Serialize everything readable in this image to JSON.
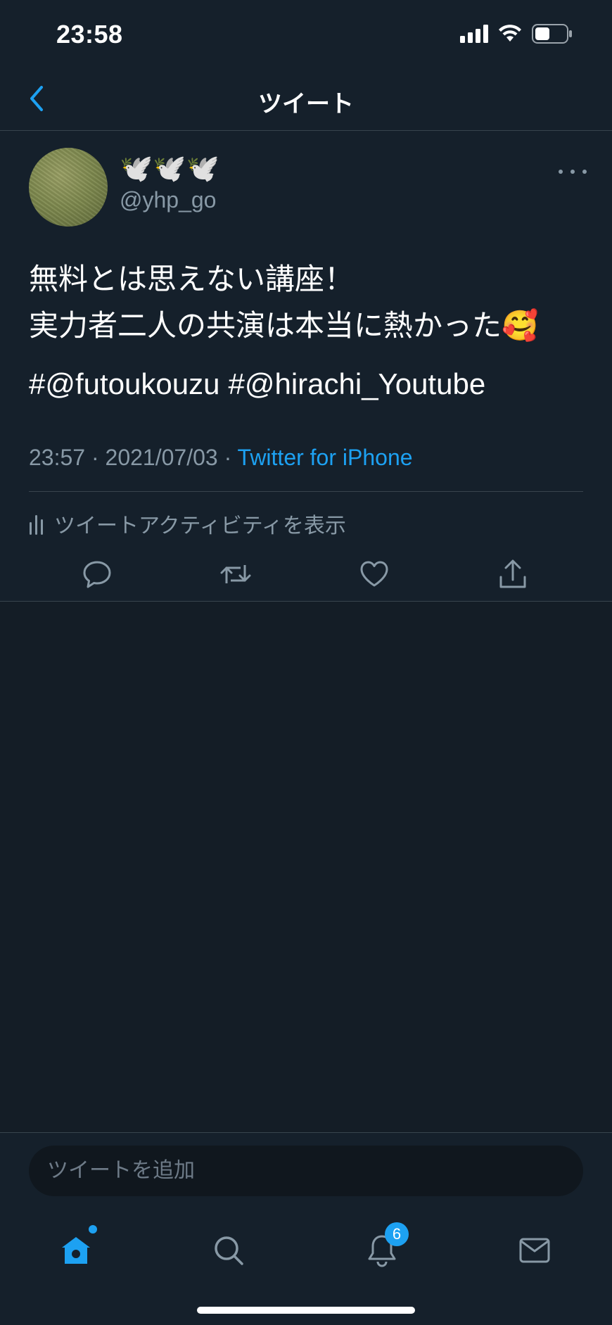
{
  "status_bar": {
    "time": "23:58"
  },
  "header": {
    "title": "ツイート"
  },
  "tweet": {
    "display_name": "🕊️🕊️🕊️",
    "handle": "@yhp_go",
    "text_lines": [
      "無料とは思えない講座！",
      "実力者二人の共演は本当に熱かった🥰"
    ],
    "hashtags": [
      "#@futoukouzu",
      "#@hirachi_Youtube"
    ],
    "time": "23:57",
    "date": "2021/07/03",
    "separator": "·",
    "source": "Twitter for iPhone",
    "activity_label": "ツイートアクティビティを表示"
  },
  "reply": {
    "placeholder": "ツイートを追加"
  },
  "tab_bar": {
    "notifications_badge": "6"
  },
  "colors": {
    "accent": "#1da1f2",
    "background": "#15202b",
    "secondary_text": "#8899a6"
  },
  "icons": {
    "back": "chevron-left-icon",
    "more": "more-horizontal-icon",
    "reply": "reply-icon",
    "retweet": "retweet-icon",
    "like": "heart-icon",
    "share": "share-icon",
    "home": "home-icon",
    "search": "search-icon",
    "notifications": "bell-icon",
    "messages": "mail-icon"
  }
}
